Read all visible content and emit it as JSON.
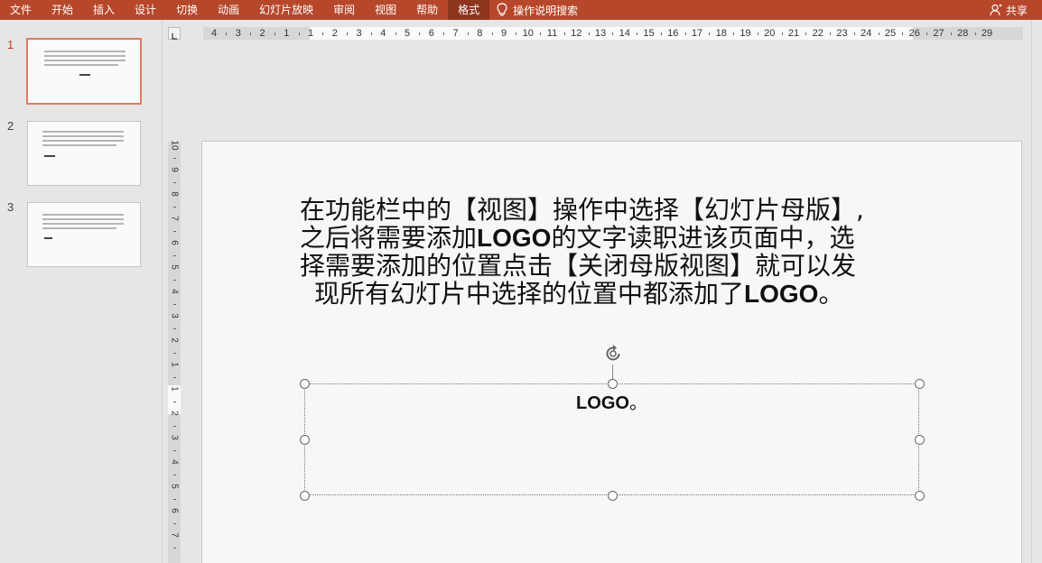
{
  "ribbon": {
    "tabs": [
      "文件",
      "开始",
      "插入",
      "设计",
      "切换",
      "动画",
      "幻灯片放映",
      "审阅",
      "视图",
      "帮助",
      "格式"
    ],
    "active_tab": "格式",
    "tell_me": "操作说明搜索",
    "share": "共享",
    "color": "#b7472a"
  },
  "thumbnails": [
    {
      "number": "1",
      "selected": true
    },
    {
      "number": "2",
      "selected": false
    },
    {
      "number": "3",
      "selected": false
    }
  ],
  "ruler": {
    "horizontal": [
      "4",
      "3",
      "2",
      "1",
      "1",
      "2",
      "3",
      "4",
      "5",
      "6",
      "7",
      "8",
      "9",
      "10",
      "11",
      "12",
      "13",
      "14",
      "15",
      "16",
      "17",
      "18",
      "19",
      "20",
      "21",
      "22",
      "23",
      "24",
      "25",
      "26",
      "27",
      "28",
      "29"
    ],
    "vertical": [
      "10",
      "9",
      "8",
      "7",
      "6",
      "5",
      "4",
      "3",
      "2",
      "1",
      "1",
      "2",
      "3",
      "4",
      "5",
      "6",
      "7"
    ]
  },
  "slide": {
    "paragraph": {
      "line1": "在功能栏中的【视图】操作中选择【幻灯片母版】,",
      "line2_pre": "之后将需要添加",
      "line2_bold": "LOGO",
      "line2_post": "的文字读职进该页面中，选",
      "line3": "择需要添加的位置点击【关闭母版视图】就可以发",
      "line4_pre": "现所有幻灯片中选择的位置中都添加了",
      "line4_bold": "LOGO",
      "line4_post": "。"
    },
    "textbox": {
      "bold": "LOGO",
      "mark": "。"
    }
  }
}
